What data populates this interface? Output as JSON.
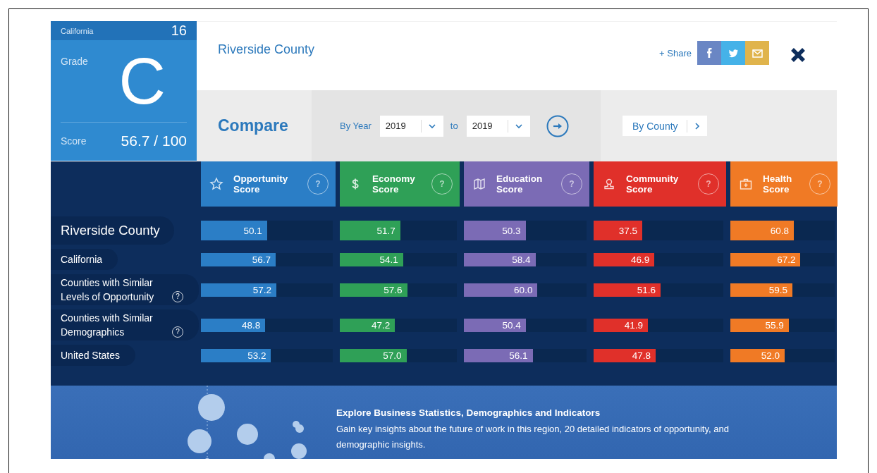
{
  "summary": {
    "state": "California",
    "rank": "16",
    "grade_label": "Grade",
    "grade": "C",
    "score_label": "Score",
    "score": "56.7 / 100"
  },
  "header": {
    "title": "Riverside County",
    "share": "+ Share",
    "share_buttons": [
      {
        "kind": "facebook",
        "color": "#6a86c4"
      },
      {
        "kind": "twitter",
        "color": "#45b2e8"
      },
      {
        "kind": "email",
        "color": "#e0b44c"
      }
    ]
  },
  "compare": {
    "title": "Compare",
    "by_year": "By Year",
    "from": "2019",
    "to_label": "to",
    "to": "2019",
    "by_county": "By County"
  },
  "columns": [
    {
      "title": "Opportunity Score",
      "kind": "star",
      "color": "#2b7ec6",
      "help": "?"
    },
    {
      "title": "Economy Score",
      "kind": "dollar",
      "color": "#2fa057",
      "help": "?"
    },
    {
      "title": "Education Score",
      "kind": "book",
      "color": "#7b6bb5",
      "help": "?"
    },
    {
      "title": "Community Score",
      "kind": "person",
      "color": "#e0302a",
      "help": "?"
    },
    {
      "title": "Health Score",
      "kind": "kit",
      "color": "#f07a25",
      "help": "?"
    }
  ],
  "rows": [
    {
      "label": "Riverside County",
      "kind": "primary",
      "values": [
        {
          "value": "50.1",
          "level": 0.501
        },
        {
          "value": "51.7",
          "level": 0.517
        },
        {
          "value": "50.3",
          "level": 0.503
        },
        {
          "value": "37.5",
          "level": 0.375
        },
        {
          "value": "60.8",
          "level": 0.608
        }
      ]
    },
    {
      "label": "California",
      "kind": "comparison",
      "values": [
        {
          "value": "56.7",
          "level": 0.567
        },
        {
          "value": "54.1",
          "level": 0.541
        },
        {
          "value": "58.4",
          "level": 0.584
        },
        {
          "value": "46.9",
          "level": 0.469
        },
        {
          "value": "67.2",
          "level": 0.672
        }
      ]
    },
    {
      "label": "Counties with Similar Levels of Opportunity",
      "kind": "comparison",
      "help": "?",
      "values": [
        {
          "value": "57.2",
          "level": 0.572
        },
        {
          "value": "57.6",
          "level": 0.576
        },
        {
          "value": "60.0",
          "level": 0.6
        },
        {
          "value": "51.6",
          "level": 0.516
        },
        {
          "value": "59.5",
          "level": 0.595
        }
      ]
    },
    {
      "label": "Counties with Similar Demographics",
      "kind": "comparison",
      "help": "?",
      "values": [
        {
          "value": "48.8",
          "level": 0.488
        },
        {
          "value": "47.2",
          "level": 0.472
        },
        {
          "value": "50.4",
          "level": 0.504
        },
        {
          "value": "41.9",
          "level": 0.419
        },
        {
          "value": "55.9",
          "level": 0.559
        }
      ]
    },
    {
      "label": "United States",
      "kind": "comparison",
      "values": [
        {
          "value": "53.2",
          "level": 0.532
        },
        {
          "value": "57.0",
          "level": 0.57
        },
        {
          "value": "56.1",
          "level": 0.561
        },
        {
          "value": "47.8",
          "level": 0.478
        },
        {
          "value": "52.0",
          "level": 0.52
        }
      ]
    }
  ],
  "banner": {
    "title": "Explore Business Statistics, Demographics and Indicators",
    "text": "Gain key insights about the future of work in this region, 20 detailed indicators of opportunity, and demographic insights."
  }
}
